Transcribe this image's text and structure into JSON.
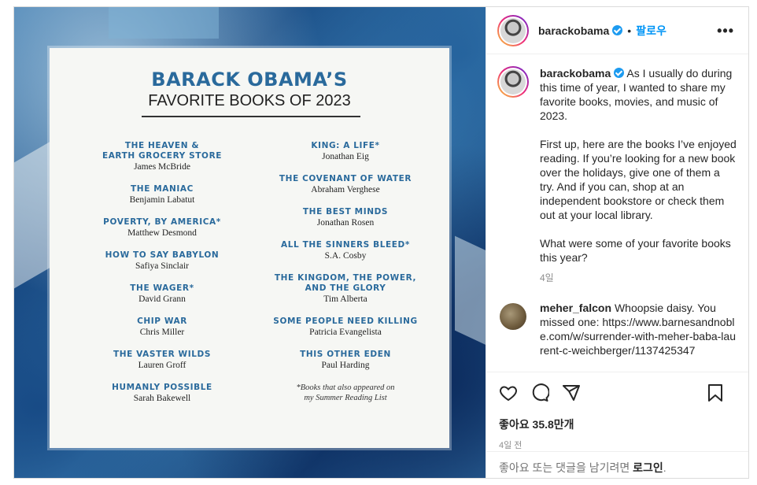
{
  "post": {
    "username": "barackobama",
    "follow_label": "팔로우",
    "separator": "•",
    "more_label": "•••",
    "caption_paragraphs": [
      "As I usually do during this time of year, I wanted to share my favorite books, movies, and music of 2023.",
      "First up, here are the books I’ve enjoyed reading. If you’re looking for a new book over the holidays, give one of them a try. And if you can, shop at an independent bookstore or check them out at your local library.",
      "What were some of your favorite books this year?"
    ],
    "caption_time": "4일",
    "likes": "좋아요 35.8만개",
    "posted_time": "4일 전",
    "login_prompt": "좋아요 또는 댓글을 남기려면",
    "login_link": "로그인",
    "login_suffix": "."
  },
  "comment": {
    "username": "meher_falcon",
    "text": "Whoopsie daisy. You missed one:",
    "url": "https://www.barnesandnoble.com/w/surrender-with-meher-baba-laurent-c-weichberger/1137425347"
  },
  "card": {
    "title": "BARACK OBAMA’S",
    "subtitle": "FAVORITE BOOKS OF 2023",
    "left_books": [
      {
        "title": "THE HEAVEN &\nEARTH GROCERY STORE",
        "author": "James McBride"
      },
      {
        "title": "THE MANIAC",
        "author": "Benjamin Labatut"
      },
      {
        "title": "POVERTY, BY AMERICA*",
        "author": "Matthew Desmond"
      },
      {
        "title": "HOW TO SAY BABYLON",
        "author": "Safiya Sinclair"
      },
      {
        "title": "THE WAGER*",
        "author": "David Grann"
      },
      {
        "title": "CHIP WAR",
        "author": "Chris Miller"
      },
      {
        "title": "THE VASTER WILDS",
        "author": "Lauren Groff"
      },
      {
        "title": "HUMANLY POSSIBLE",
        "author": "Sarah Bakewell"
      }
    ],
    "right_books": [
      {
        "title": "KING: A LIFE*",
        "author": "Jonathan Eig"
      },
      {
        "title": "THE COVENANT OF WATER",
        "author": "Abraham Verghese"
      },
      {
        "title": "THE BEST MINDS",
        "author": "Jonathan Rosen"
      },
      {
        "title": "ALL THE SINNERS BLEED*",
        "author": "S.A. Cosby"
      },
      {
        "title": "THE KINGDOM, THE POWER,\nAND THE GLORY",
        "author": "Tim Alberta"
      },
      {
        "title": "SOME PEOPLE NEED KILLING",
        "author": "Patricia Evangelista"
      },
      {
        "title": "THIS OTHER EDEN",
        "author": "Paul Harding"
      }
    ],
    "note": "*Books that also appeared on\nmy Summer Reading List"
  },
  "colors": {
    "accent": "#0095f6",
    "title_blue": "#2a6a9c",
    "verified": "#1d9bf0"
  },
  "icons": [
    "heart-icon",
    "comment-icon",
    "share-icon",
    "bookmark-icon",
    "verified-icon",
    "more-options-icon"
  ]
}
